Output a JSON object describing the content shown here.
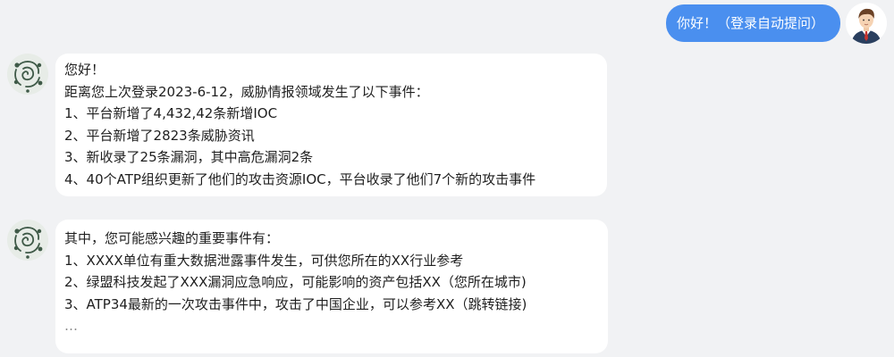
{
  "user_message": {
    "text": "你好！（登录自动提问）"
  },
  "bot_messages": [
    {
      "lines": [
        "您好！",
        "距离您上次登录2023-6-12，威胁情报领域发生了以下事件：",
        "1、平台新增了4,432,42条新增IOC",
        "2、平台新增了2823条威胁资讯",
        "3、新收录了25条漏洞，其中高危漏洞2条",
        "4、40个ATP组织更新了他们的攻击资源IOC，平台收录了他们7个新的攻击事件"
      ]
    },
    {
      "lines": [
        "其中，您可能感兴趣的重要事件有：",
        "1、XXXX单位有重大数据泄露事件发生，可供您所在的XX行业参考",
        "2、绿盟科技发起了XXX漏洞应急响应，可能影响的资产包括XX（您所在城市)",
        "3、ATP34最新的一次攻击事件中，攻击了中国企业，可以参考XX（跳转链接)",
        "…"
      ]
    }
  ],
  "colors": {
    "background": "#f1f2f4",
    "user_bubble": "#4a8fef",
    "bot_bubble": "#ffffff"
  },
  "icons": {
    "user_avatar": "businessman-avatar-icon",
    "bot_avatar": "bot-logo-avatar-icon"
  }
}
